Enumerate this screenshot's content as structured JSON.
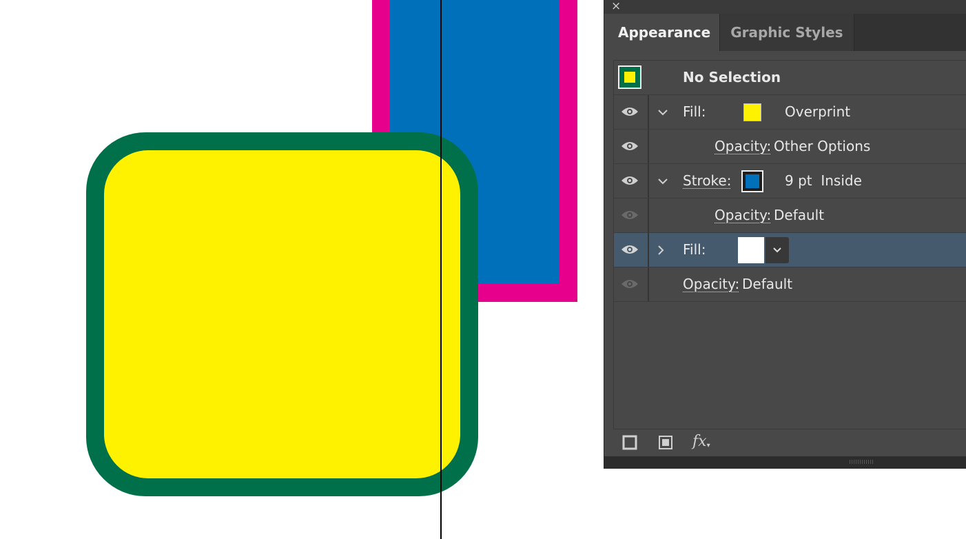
{
  "artboard": {
    "shapes": [
      {
        "name": "magenta-rectangle",
        "color": "#e6008c"
      },
      {
        "name": "blue-rectangle",
        "color": "#0070bb"
      },
      {
        "name": "green-rounded-square",
        "color": "#00704a"
      },
      {
        "name": "yellow-rounded-square",
        "color": "#fff200"
      }
    ]
  },
  "panel": {
    "close_label": "×",
    "tabs": [
      {
        "label": "Appearance",
        "active": true
      },
      {
        "label": "Graphic Styles",
        "active": false
      }
    ],
    "header": {
      "label": "No Selection"
    },
    "rows": [
      {
        "kind": "fill",
        "label": "Fill:",
        "swatch_color": "#fff200",
        "value": "Overprint",
        "expanded": true
      },
      {
        "kind": "opacity",
        "label": "Opacity:",
        "value": "Other Options"
      },
      {
        "kind": "stroke",
        "label": "Stroke:",
        "swatch_color": "#0070bb",
        "value": "9 pt  Inside",
        "expanded": true
      },
      {
        "kind": "opacity",
        "label": "Opacity:",
        "value": "Default"
      },
      {
        "kind": "fill",
        "label": "Fill:",
        "swatch_color": "#ffffff",
        "expanded": false,
        "selected": true
      },
      {
        "kind": "opacity",
        "label": "Opacity:",
        "value": "Default"
      }
    ],
    "footer": {
      "icons": [
        "add-new-stroke-icon",
        "add-new-fill-icon",
        "add-new-effect-icon"
      ],
      "fx_label": "fx"
    }
  }
}
